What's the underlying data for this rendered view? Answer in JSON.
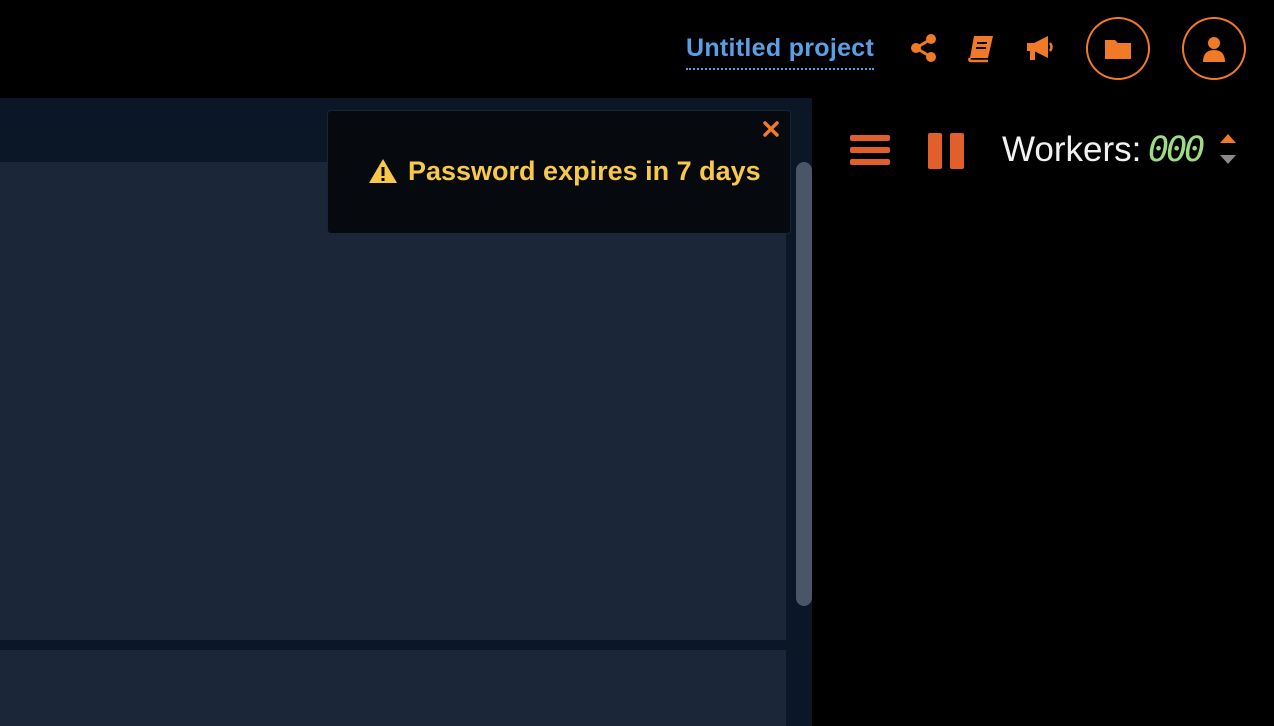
{
  "header": {
    "project_title": "Untitled project",
    "icons": [
      "share-icon",
      "book-icon",
      "megaphone-icon",
      "folder-icon",
      "user-icon"
    ]
  },
  "notification": {
    "message": "Password expires in 7 days",
    "icon": "warning-icon",
    "close_icon": "close-icon"
  },
  "controls": {
    "workers_label": "Workers:",
    "workers_count": "000"
  },
  "colors": {
    "accent": "#f07a28",
    "link": "#5aa0e6",
    "warning": "#f7c84a",
    "counter": "#9ddc82",
    "panel": "#1b2639",
    "panel_dark": "#0b1626"
  }
}
